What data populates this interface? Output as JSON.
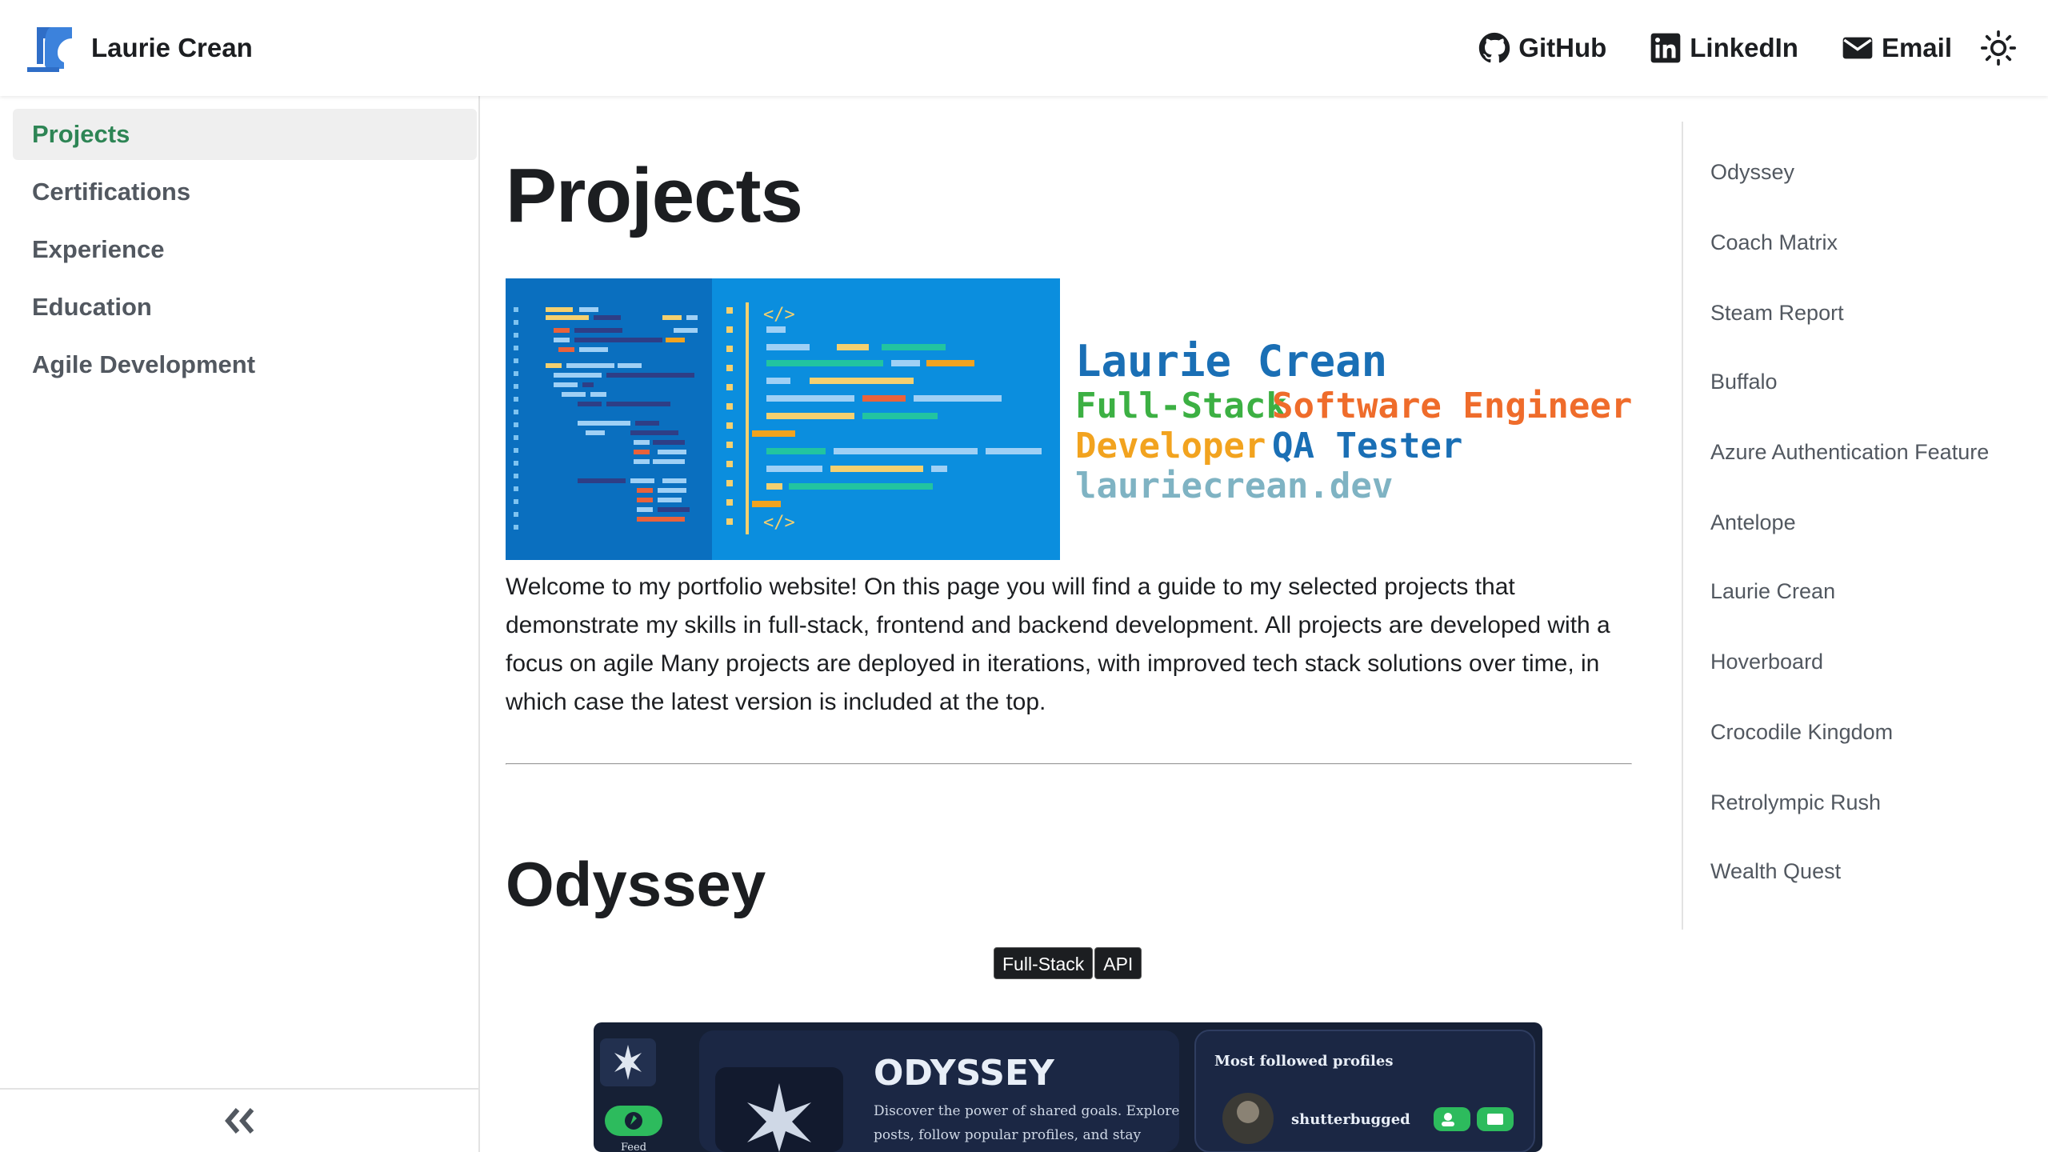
{
  "navbar": {
    "brand_name": "Laurie Crean",
    "links": [
      {
        "label": "GitHub",
        "icon": "github-icon"
      },
      {
        "label": "LinkedIn",
        "icon": "linkedin-icon"
      },
      {
        "label": "Email",
        "icon": "email-icon"
      }
    ],
    "theme_icon": "sun-icon"
  },
  "sidebar": {
    "items": [
      {
        "label": "Projects",
        "active": true
      },
      {
        "label": "Certifications"
      },
      {
        "label": "Experience"
      },
      {
        "label": "Education"
      },
      {
        "label": "Agile Development"
      }
    ],
    "collapse_icon": "double-chevron-left-icon"
  },
  "main": {
    "title": "Projects",
    "banner": {
      "name": "Laurie Crean",
      "line2_a": "Full-Stack",
      "line2_b": "Software Engineer",
      "line3_a": "Developer",
      "line3_b": "QA Tester",
      "url": "lauriecrean.dev"
    },
    "intro": "Welcome to my portfolio website! On this page you will find a guide to my selected projects that demonstrate my skills in full-stack, frontend and backend development. All projects are developed with a focus on agile Many projects are deployed in iterations, with improved tech stack solutions over time, in which case the latest version is included at the top.",
    "section_title": "Odyssey",
    "tags": [
      "Full-Stack",
      "API"
    ],
    "screenshot": {
      "app_title": "ODYSSEY",
      "tagline_1": "Discover the power of shared goals. Explore",
      "tagline_2": "posts, follow popular profiles, and stay",
      "panel_title": "Most followed profiles",
      "profile_name": "shutterbugged",
      "nav_label": "Feed"
    }
  },
  "toc": {
    "items": [
      "Odyssey",
      "Coach Matrix",
      "Steam Report",
      "Buffalo",
      "Azure Authentication Feature",
      "Antelope",
      "Laurie Crean",
      "Hoverboard",
      "Crocodile Kingdom",
      "Retrolympic Rush",
      "Wealth Quest"
    ]
  },
  "colors": {
    "accent": "#2e8555",
    "banner_blue": "#0b8ede",
    "banner_dark": "#0a6fbf",
    "name_blue": "#1a6fb5",
    "green": "#3cb043",
    "orange": "#ef6c2b",
    "yellow": "#f2a31f",
    "teal": "#7fb3c3",
    "navy": "#1d2a4a"
  }
}
